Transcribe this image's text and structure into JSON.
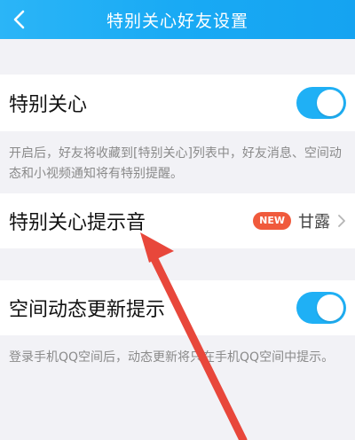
{
  "nav": {
    "title": "特别关心好友设置",
    "back_icon": "chevron-left-icon",
    "colors": {
      "bar": "#19aaf4",
      "text": "#ffffff"
    }
  },
  "special_care": {
    "label": "特别关心",
    "enabled": true,
    "description": "开启后，好友将收藏到[特别关心]列表中，好友消息、空间动态和小视频通知将有特别提醒。"
  },
  "alert_sound": {
    "label": "特别关心提示音",
    "badge": "NEW",
    "value": "甘露",
    "chevron_icon": "chevron-right-icon"
  },
  "zone_update": {
    "label": "空间动态更新提示",
    "enabled": true,
    "description": "登录手机QQ空间后，动态更新将只在手机QQ空间中提示。"
  },
  "colors": {
    "toggle_on": "#1fb0f5",
    "badge": "#f05a3c",
    "annotation_arrow": "#e8473b",
    "background": "#f2f2f6"
  },
  "annotation": {
    "icon": "red-arrow-icon"
  }
}
